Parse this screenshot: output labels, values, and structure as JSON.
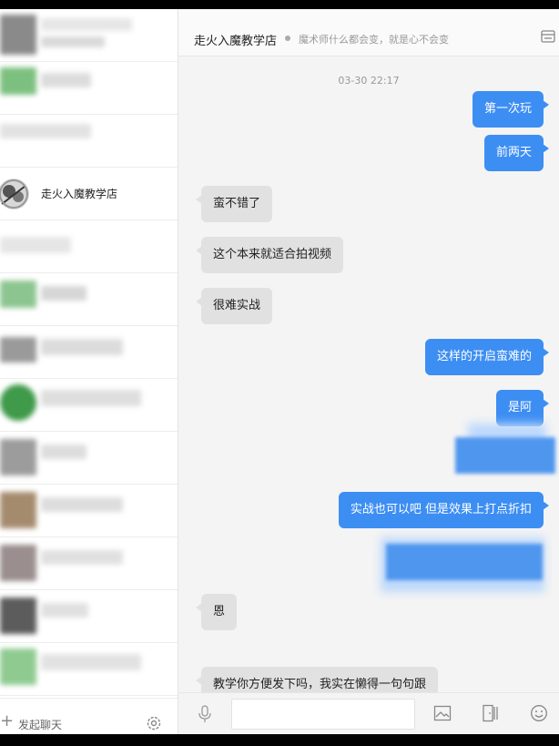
{
  "sidebar": {
    "active_contact_name": "走火入魔教学店",
    "new_chat_label": "发起聊天"
  },
  "chat": {
    "title": "走火入魔教学店",
    "subtitle": "魔术师什么都会变，就是心不会变",
    "timestamp": "03-30 22:17",
    "messages": [
      {
        "dir": "out",
        "text": "第一次玩"
      },
      {
        "dir": "out",
        "text": "前两天"
      },
      {
        "dir": "in",
        "text": "蛮不错了"
      },
      {
        "dir": "in",
        "text": "这个本来就适合拍视频"
      },
      {
        "dir": "in",
        "text": "很难实战"
      },
      {
        "dir": "out",
        "text": "这样的开启蛮难的"
      },
      {
        "dir": "out",
        "text": "是阿"
      },
      {
        "dir": "out",
        "text": "实战也可以吧 但是效果上打点折扣"
      },
      {
        "dir": "in",
        "text": "恩"
      },
      {
        "dir": "in",
        "text": "教学你方便发下吗，我实在懒得一句句跟"
      }
    ]
  },
  "colors": {
    "outgoing_bubble": "#3d8ef3",
    "incoming_bubble": "#e1e1e1",
    "chat_background": "#f4f4f4"
  },
  "icons": {
    "header": "list-icon",
    "composer": [
      "microphone-icon",
      "image-icon",
      "file-icon",
      "emoji-icon"
    ],
    "sidebar_footer": [
      "plus-icon",
      "gear-icon"
    ]
  }
}
